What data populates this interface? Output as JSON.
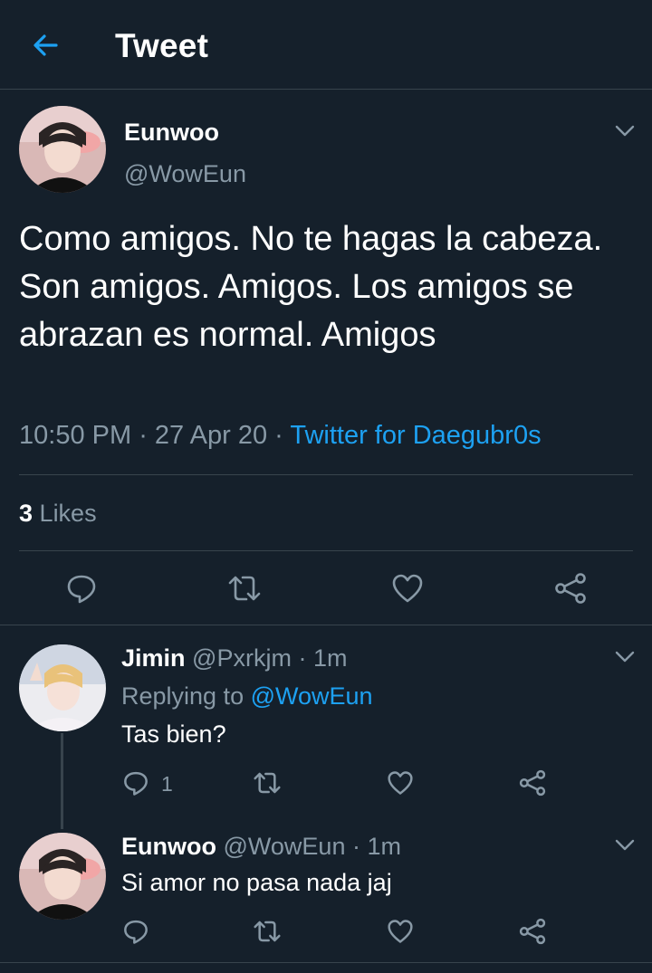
{
  "header": {
    "title": "Tweet",
    "back_icon": "arrow-left-icon"
  },
  "main_tweet": {
    "name": "Eunwoo",
    "handle": "@WowEun",
    "text": "Como amigos. No te hagas la cabeza. Son amigos. Amigos. Los amigos se abrazan es normal. Amigos",
    "time": "10:50 PM",
    "date": "27 Apr 20",
    "source": "Twitter for Daegubr0s",
    "likes_count": "3",
    "likes_label": "Likes",
    "actions": [
      "reply-icon",
      "retweet-icon",
      "like-icon",
      "share-icon"
    ]
  },
  "replies": [
    {
      "name": "Jimin",
      "handle": "@Pxrkjm",
      "time": "1m",
      "replying_label": "Replying to",
      "replying_to": "@WowEun",
      "text": "Tas bien?",
      "reply_count": "1"
    },
    {
      "name": "Eunwoo",
      "handle": "@WowEun",
      "time": "1m",
      "text": "Si amor no pasa nada jaj"
    }
  ],
  "colors": {
    "background": "#15202b",
    "accent": "#1da1f2",
    "muted": "#8899a6",
    "divider": "#38444d"
  }
}
